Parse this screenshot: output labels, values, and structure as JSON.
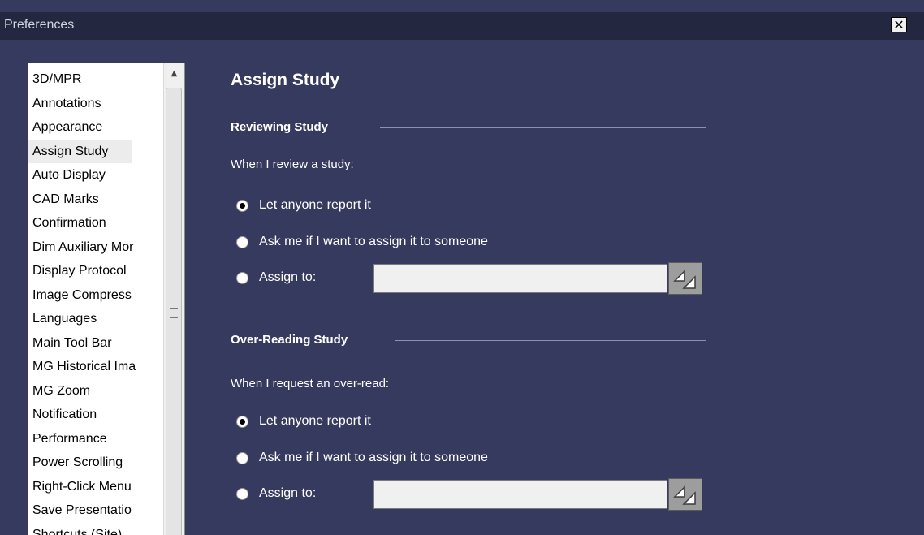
{
  "window": {
    "title": "Preferences",
    "close_label": "✕"
  },
  "nav": {
    "items": [
      {
        "label": "3D/MPR"
      },
      {
        "label": "Annotations"
      },
      {
        "label": "Appearance"
      },
      {
        "label": "Assign Study",
        "selected": true
      },
      {
        "label": "Auto Display"
      },
      {
        "label": "CAD Marks"
      },
      {
        "label": "Confirmation"
      },
      {
        "label": "Dim Auxiliary Mor"
      },
      {
        "label": "Display Protocol"
      },
      {
        "label": "Image Compress"
      },
      {
        "label": "Languages"
      },
      {
        "label": "Main Tool Bar"
      },
      {
        "label": "MG Historical Ima"
      },
      {
        "label": "MG Zoom"
      },
      {
        "label": "Notification"
      },
      {
        "label": "Performance"
      },
      {
        "label": "Power Scrolling"
      },
      {
        "label": "Right-Click Menu"
      },
      {
        "label": "Save Presentatio"
      },
      {
        "label": "Shortcuts (Site)"
      }
    ],
    "scroll_up_icon": "▲"
  },
  "content": {
    "title": "Assign Study",
    "reviewing": {
      "heading": "Reviewing Study",
      "prompt": "When I review a study:",
      "options": [
        {
          "label": "Let anyone report it",
          "checked": true
        },
        {
          "label": "Ask me if I want to assign it to someone",
          "checked": false
        },
        {
          "label": "Assign to:",
          "checked": false
        }
      ],
      "assign_value": ""
    },
    "overreading": {
      "heading": "Over-Reading Study",
      "prompt": "When I request an over-read:",
      "options": [
        {
          "label": "Let anyone report it",
          "checked": true
        },
        {
          "label": "Ask me if I want to assign it to someone",
          "checked": false
        },
        {
          "label": "Assign to:",
          "checked": false
        }
      ],
      "assign_value": ""
    }
  },
  "colors": {
    "background": "#373a5f",
    "titlebar": "#23273f",
    "text": "#ffffff"
  }
}
